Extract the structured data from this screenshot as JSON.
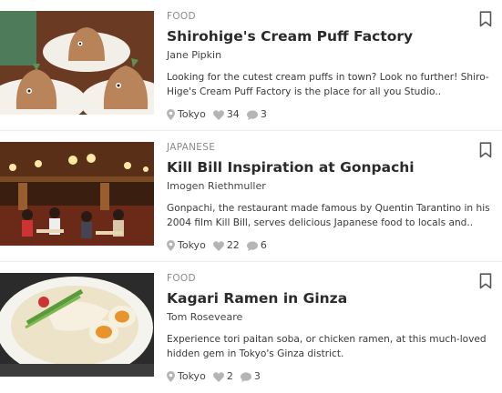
{
  "articles": [
    {
      "category": "FOOD",
      "title": "Shirohige's Cream Puff Factory",
      "author": "Jane Pipkin",
      "excerpt": "Looking for the cutest cream puffs in town? Look no further! Shiro-Hige's Cream Puff Factory is the place for all you Studio..",
      "location": "Tokyo",
      "likes": "34",
      "comments": "3",
      "image": "cream-puff-image"
    },
    {
      "category": "JAPANESE",
      "title": "Kill Bill Inspiration at Gonpachi",
      "author": "Imogen Riethmuller",
      "excerpt": "Gonpachi, the restaurant made famous by Quentin Tarantino in his 2004 film Kill Bill, serves delicious Japanese food to locals and..",
      "location": "Tokyo",
      "likes": "22",
      "comments": "6",
      "image": "restaurant-interior-image"
    },
    {
      "category": "FOOD",
      "title": "Kagari Ramen in Ginza",
      "author": "Tom Roseveare",
      "excerpt": "Experience tori paitan soba, or chicken ramen, at this much-loved hidden gem in Tokyo's Ginza district.",
      "location": "Tokyo",
      "likes": "2",
      "comments": "3",
      "image": "ramen-bowl-image"
    }
  ],
  "icons": {
    "location": "map-pin-icon",
    "likes": "heart-icon",
    "comments": "speech-bubble-icon",
    "bookmark": "bookmark-icon"
  },
  "colors": {
    "meta_icon": "#b5b5b5",
    "category": "#8a8a8a",
    "divider": "#ebebeb"
  }
}
